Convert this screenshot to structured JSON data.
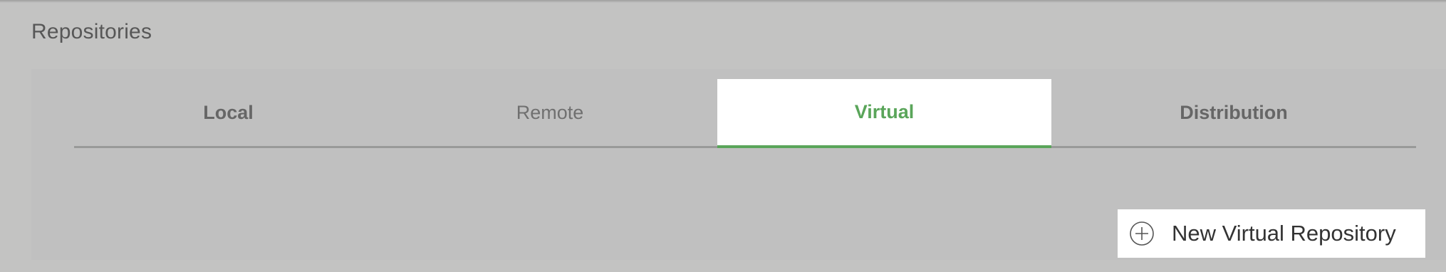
{
  "page": {
    "title": "Repositories"
  },
  "tabs": [
    {
      "label": "Local"
    },
    {
      "label": "Remote"
    },
    {
      "label": "Virtual",
      "active": true
    },
    {
      "label": "Distribution"
    }
  ],
  "actions": {
    "new_repository_label": "New Virtual Repository",
    "new_repository_icon": "plus-circle-icon"
  },
  "colors": {
    "accent": "#5aa55a",
    "background": "#c3c3c2"
  }
}
